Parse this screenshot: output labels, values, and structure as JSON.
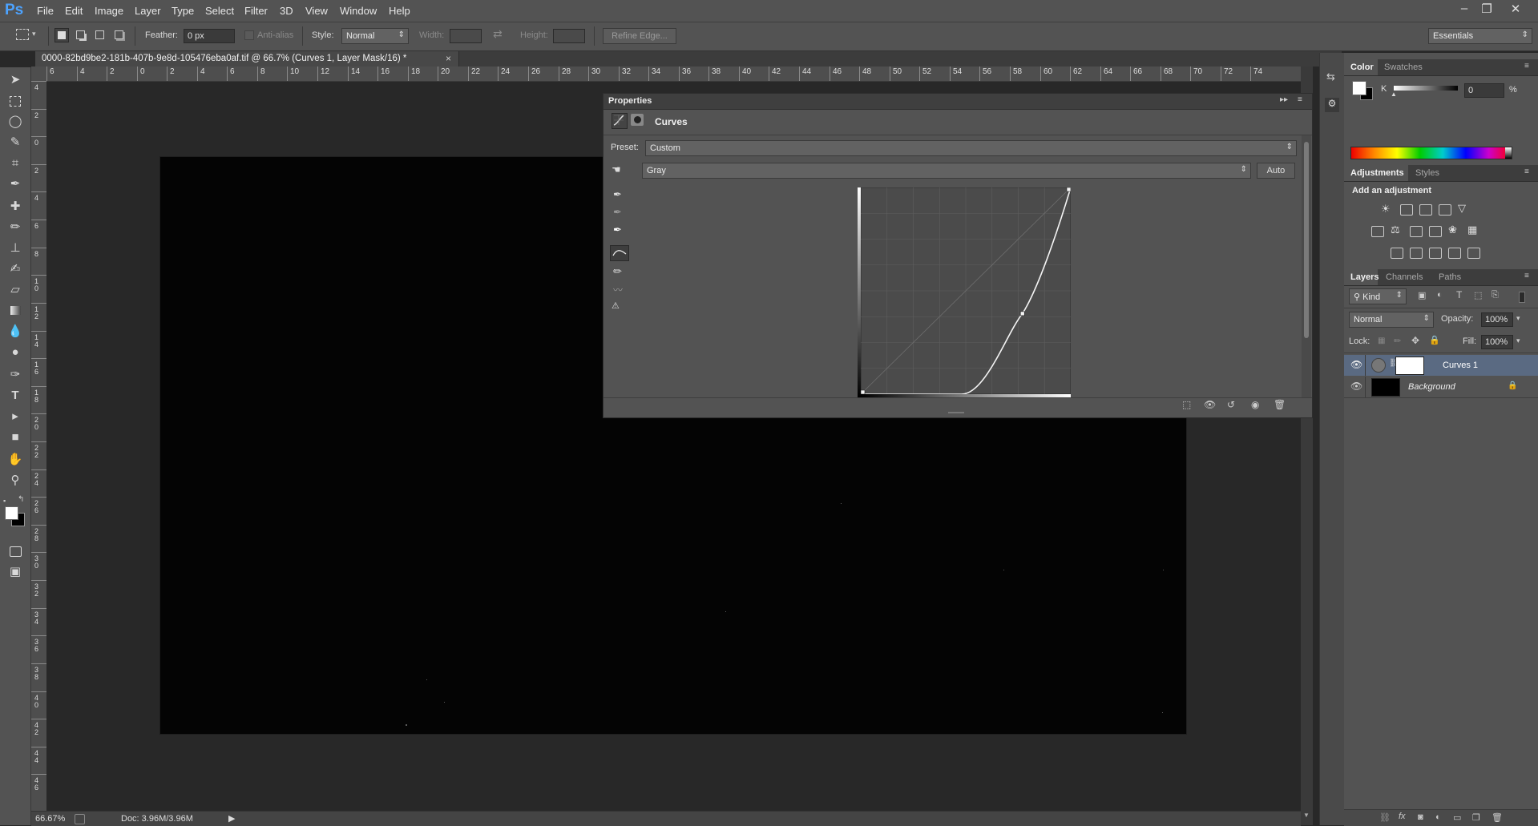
{
  "menubar": {
    "logo": "Ps",
    "items": [
      "File",
      "Edit",
      "Image",
      "Layer",
      "Type",
      "Select",
      "Filter",
      "3D",
      "View",
      "Window",
      "Help"
    ],
    "window_controls": {
      "minimize": "–",
      "restore": "❐",
      "close": "✕"
    }
  },
  "options": {
    "feather_label": "Feather:",
    "feather_value": "0 px",
    "antialias_label": "Anti-alias",
    "style_label": "Style:",
    "style_value": "Normal",
    "width_label": "Width:",
    "height_label": "Height:",
    "refine_edge": "Refine Edge...",
    "workspace": "Essentials"
  },
  "document": {
    "tab_title": "0000-82bd9be2-181b-407b-9e8d-105476eba0af.tif @ 66.7% (Curves 1, Layer Mask/16) *",
    "tab_close": "×"
  },
  "rulers": {
    "top_labels": [
      "6",
      "4",
      "2",
      "0",
      "2",
      "4",
      "6",
      "8",
      "10",
      "12",
      "14",
      "16",
      "18",
      "20",
      "22",
      "24",
      "26",
      "28",
      "30",
      "32",
      "34",
      "36",
      "38",
      "40",
      "42",
      "44",
      "46",
      "48",
      "50",
      "52",
      "54",
      "56",
      "58",
      "60",
      "62",
      "64",
      "66",
      "68",
      "70",
      "72",
      "74"
    ],
    "left_labels": [
      "4",
      "2",
      "0",
      "2",
      "4",
      "6",
      "8",
      "10",
      "12",
      "14",
      "16",
      "18",
      "20",
      "22",
      "24",
      "26",
      "28",
      "30",
      "32",
      "34",
      "36",
      "38",
      "40",
      "42",
      "44",
      "46"
    ]
  },
  "status": {
    "zoom": "66.67%",
    "doc": "Doc: 3.96M/3.96M"
  },
  "properties": {
    "panel_title": "Properties",
    "adjustment_name": "Curves",
    "preset_label": "Preset:",
    "preset_value": "Custom",
    "channel_value": "Gray",
    "auto_button": "Auto",
    "curve_points": [
      [
        0,
        0
      ],
      [
        0.48,
        0
      ],
      [
        0.77,
        0.39
      ],
      [
        1,
        1
      ]
    ]
  },
  "color_panel": {
    "tabs": [
      "Color",
      "Swatches"
    ],
    "channel_label": "K",
    "value": "0",
    "unit": "%",
    "slider_level": 0
  },
  "adjustments_panel": {
    "tabs": [
      "Adjustments",
      "Styles"
    ],
    "heading": "Add an adjustment"
  },
  "layers_panel": {
    "tabs": [
      "Layers",
      "Channels",
      "Paths"
    ],
    "filter_kind": "Kind",
    "blend_mode": "Normal",
    "opacity_label": "Opacity:",
    "opacity_value": "100%",
    "lock_label": "Lock:",
    "fill_label": "Fill:",
    "fill_value": "100%",
    "layers": [
      {
        "name": "Curves 1",
        "selected": true
      },
      {
        "name": "Background",
        "selected": false
      }
    ]
  },
  "colors": {
    "accent": "#4da3ff",
    "panel_bg": "#535353",
    "canvas_bg": "#282828",
    "image_bg": "#040404",
    "selected_layer": "#5a6a82"
  }
}
